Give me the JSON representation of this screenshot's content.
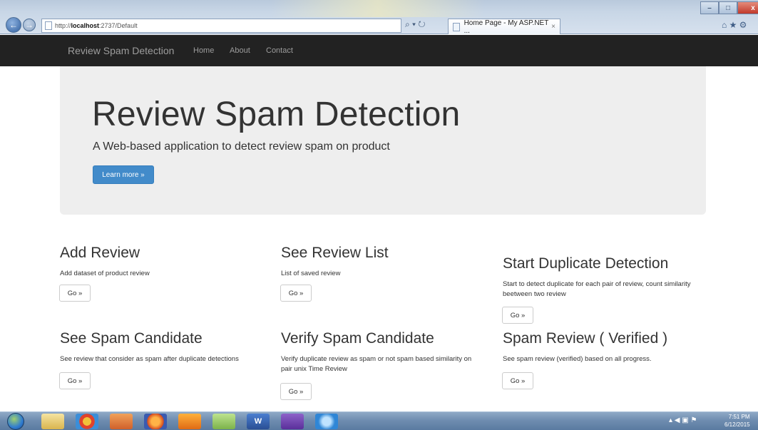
{
  "browser": {
    "url_prefix": "http://",
    "url_host": "localhost",
    "url_rest": ":2737/Default",
    "search_refresh_icons": "⌕ ▾ ↻",
    "tab_title": "Home Page - My ASP.NET ...",
    "tab_close": "×",
    "back_glyph": "←",
    "forward_glyph": "→",
    "right_icons": "⌂ ★ ⚙",
    "window_min": "–",
    "window_max": "□",
    "window_close": "x"
  },
  "navbar": {
    "brand": "Review Spam Detection",
    "links": [
      "Home",
      "About",
      "Contact"
    ]
  },
  "jumbotron": {
    "title": "Review Spam Detection",
    "lead": "A Web-based application to detect review spam on product",
    "button": "Learn more »"
  },
  "features": [
    {
      "title": "Add Review",
      "desc": "Add dataset of  product review",
      "button": "Go »"
    },
    {
      "title": "See Review List",
      "desc": "List of saved review",
      "button": "Go »"
    },
    {
      "title": "Start Duplicate Detection",
      "desc": "Start to detect duplicate for each pair of review, count similarity beetween two review",
      "button": "Go »"
    },
    {
      "title": "See Spam Candidate",
      "desc": "See review that consider as spam after duplicate detections",
      "button": "Go »"
    },
    {
      "title": "Verify Spam Candidate",
      "desc": "Verify duplicate review as spam or not spam based similarity on pair unix Time Review",
      "button": "Go »"
    },
    {
      "title": "Spam Review ( Verified )",
      "desc": "See spam review (verified) based on all progress.",
      "button": "Go »"
    }
  ],
  "taskbar": {
    "word_label": "W",
    "tray": "▴ ◀ ▣ ⚑",
    "time": "7:51 PM",
    "date": "6/12/2015"
  },
  "colors": {
    "navbar_bg": "#222222",
    "jumbotron_bg": "#eeeeee",
    "primary_button": "#428bca"
  }
}
